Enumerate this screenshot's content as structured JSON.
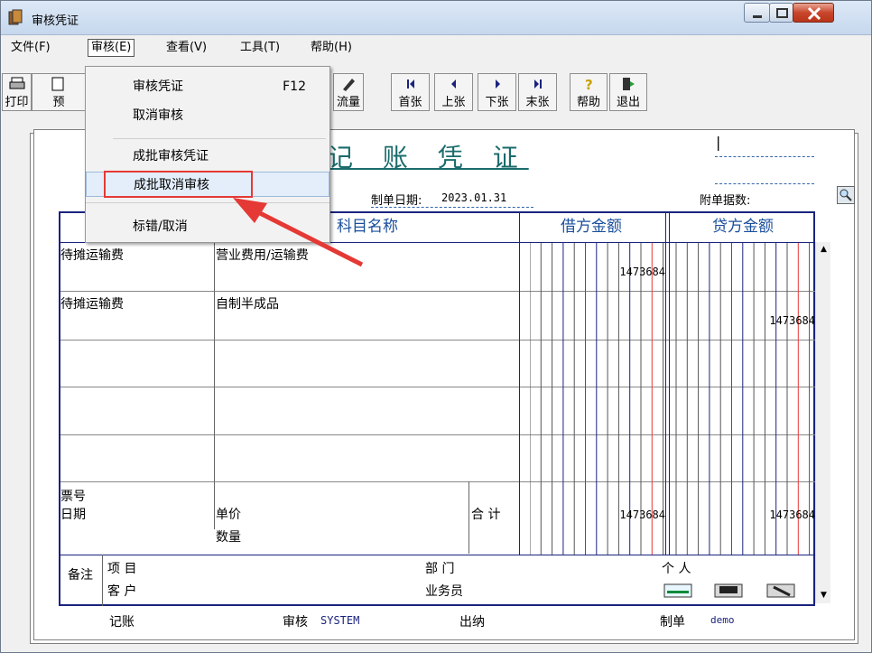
{
  "window": {
    "title": "审核凭证"
  },
  "menubar": [
    "文件(F)",
    "审核(E)",
    "查看(V)",
    "工具(T)",
    "帮助(H)"
  ],
  "toolbar": {
    "print": "打印",
    "preview": "预",
    "flow": "流量",
    "first": "首张",
    "prev": "上张",
    "next": "下张",
    "last": "末张",
    "help": "帮助",
    "exit": "退出"
  },
  "dropdown": {
    "items": [
      {
        "label": "审核凭证",
        "shortcut": "F12"
      },
      {
        "label": "取消审核"
      },
      {
        "label": "成批审核凭证"
      },
      {
        "label": "成批取消审核"
      },
      {
        "label": "标错/取消"
      }
    ]
  },
  "voucher": {
    "title": "记 账 凭 证",
    "date_label": "制单日期:",
    "date": "2023.01.31",
    "attach_label": "附单据数:",
    "headers": {
      "account": "科目名称",
      "debit": "借方金额",
      "credit": "贷方金额"
    },
    "rows": [
      {
        "summary": "待摊运输费",
        "account": "营业费用/运输费",
        "debit": "1473684",
        "credit": ""
      },
      {
        "summary": "待摊运输费",
        "account": "自制半成品",
        "debit": "",
        "credit": "1473684"
      }
    ],
    "footer": {
      "ticket_no": "票号",
      "date": "日期",
      "unit_price": "单价",
      "quantity": "数量",
      "total_label": "合 计",
      "total_debit": "1473684",
      "total_credit": "1473684"
    },
    "notes": {
      "label": "备注",
      "project": "项 目",
      "department": "部 门",
      "person": "个 人",
      "customer": "客 户",
      "salesman": "业务员"
    },
    "signoff": {
      "bookkeep": "记账",
      "audit": "审核",
      "auditor": "SYSTEM",
      "cashier": "出纳",
      "maker": "制单",
      "maker_name": "demo"
    }
  },
  "colors": {
    "accent": "#1a6b6b",
    "highlight": "#e53935",
    "grid_border": "#1a237e"
  }
}
